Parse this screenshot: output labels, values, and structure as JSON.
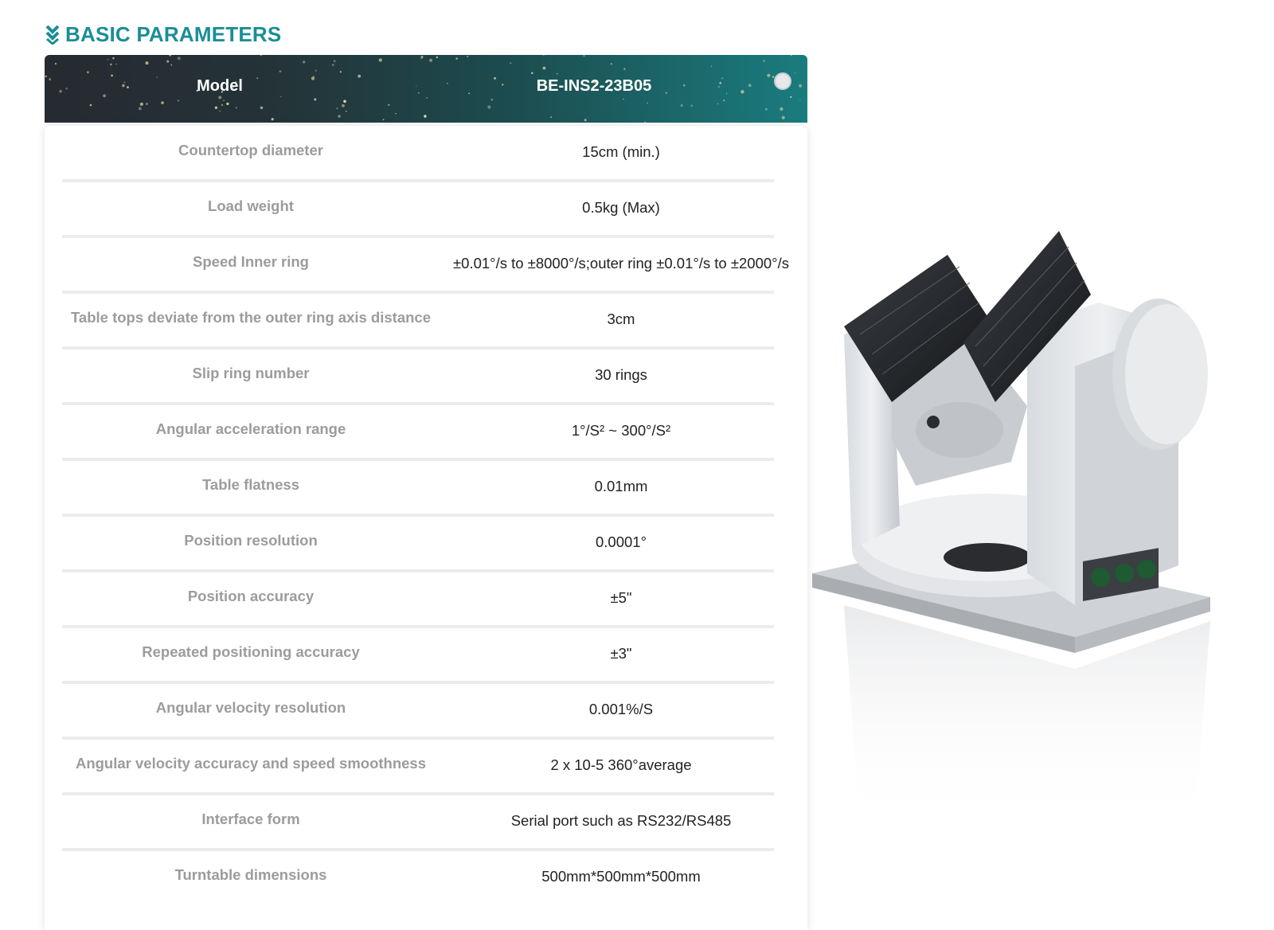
{
  "section": {
    "title": "BASIC PARAMETERS",
    "icon": "double-chevron-down-icon",
    "accent_color": "#1a8e95"
  },
  "header": {
    "left_label": "Model",
    "right_label": "BE-INS2-23B05"
  },
  "rows": [
    {
      "label": "Countertop diameter",
      "value": "15cm (min.)"
    },
    {
      "label": "Load weight",
      "value": "0.5kg (Max)"
    },
    {
      "label": "Speed Inner ring",
      "value": "±0.01°/s to ±8000°/s;outer ring ±0.01°/s to ±2000°/s"
    },
    {
      "label": "Table tops deviate from the outer ring axis distance",
      "value": "3cm"
    },
    {
      "label": "Slip ring number",
      "value": "30 rings"
    },
    {
      "label": "Angular acceleration range",
      "value": "1°/S² ~ 300°/S²"
    },
    {
      "label": "Table flatness",
      "value": "0.01mm"
    },
    {
      "label": "Position resolution",
      "value": "0.0001°"
    },
    {
      "label": "Position accuracy",
      "value": "±5\""
    },
    {
      "label": "Repeated positioning accuracy",
      "value": "±3\""
    },
    {
      "label": "Angular velocity resolution",
      "value": "0.001%/S"
    },
    {
      "label": "Angular velocity accuracy and speed smoothness",
      "value": "2 x 10-5 360°average"
    },
    {
      "label": "Interface form",
      "value": "Serial port such as RS232/RS485"
    },
    {
      "label": "Turntable dimensions",
      "value": "500mm*500mm*500mm"
    }
  ]
}
